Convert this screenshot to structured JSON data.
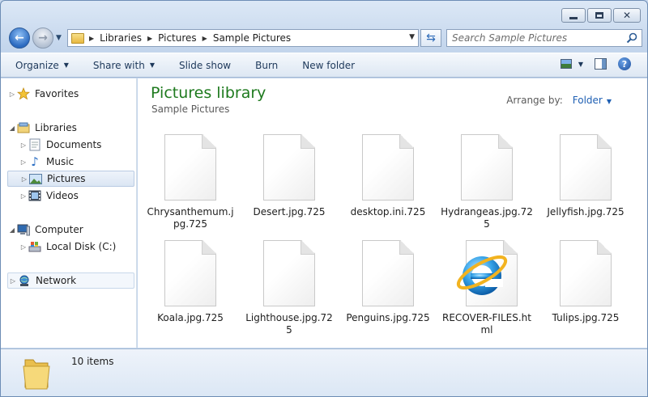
{
  "window": {
    "title": "Pictures library"
  },
  "address": {
    "crumbs": [
      "Libraries",
      "Pictures",
      "Sample Pictures"
    ]
  },
  "search": {
    "placeholder": "Search Sample Pictures"
  },
  "toolbar": {
    "organize": "Organize",
    "share_with": "Share with",
    "slide_show": "Slide show",
    "burn": "Burn",
    "new_folder": "New folder"
  },
  "nav": {
    "favorites": "Favorites",
    "libraries": "Libraries",
    "documents": "Documents",
    "music": "Music",
    "pictures": "Pictures",
    "videos": "Videos",
    "computer": "Computer",
    "local_disk": "Local Disk (C:)",
    "network": "Network"
  },
  "content": {
    "title": "Pictures library",
    "subtitle": "Sample Pictures",
    "arrange_label": "Arrange by:",
    "arrange_value": "Folder"
  },
  "files": [
    {
      "name": "Chrysanthemum.jpg.725",
      "icon": "blank-document-icon"
    },
    {
      "name": "Desert.jpg.725",
      "icon": "blank-document-icon"
    },
    {
      "name": "desktop.ini.725",
      "icon": "blank-document-icon"
    },
    {
      "name": "Hydrangeas.jpg.725",
      "icon": "blank-document-icon"
    },
    {
      "name": "Jellyfish.jpg.725",
      "icon": "blank-document-icon"
    },
    {
      "name": "Koala.jpg.725",
      "icon": "blank-document-icon"
    },
    {
      "name": "Lighthouse.jpg.725",
      "icon": "blank-document-icon"
    },
    {
      "name": "Penguins.jpg.725",
      "icon": "blank-document-icon"
    },
    {
      "name": "RECOVER-FILES.html",
      "icon": "internet-explorer-icon"
    },
    {
      "name": "Tulips.jpg.725",
      "icon": "blank-document-icon"
    }
  ],
  "details": {
    "count": "10 items"
  },
  "colors": {
    "title_green": "#1e7a1e",
    "link_blue": "#1e5fb3",
    "chrome": "#c9d9ee"
  }
}
